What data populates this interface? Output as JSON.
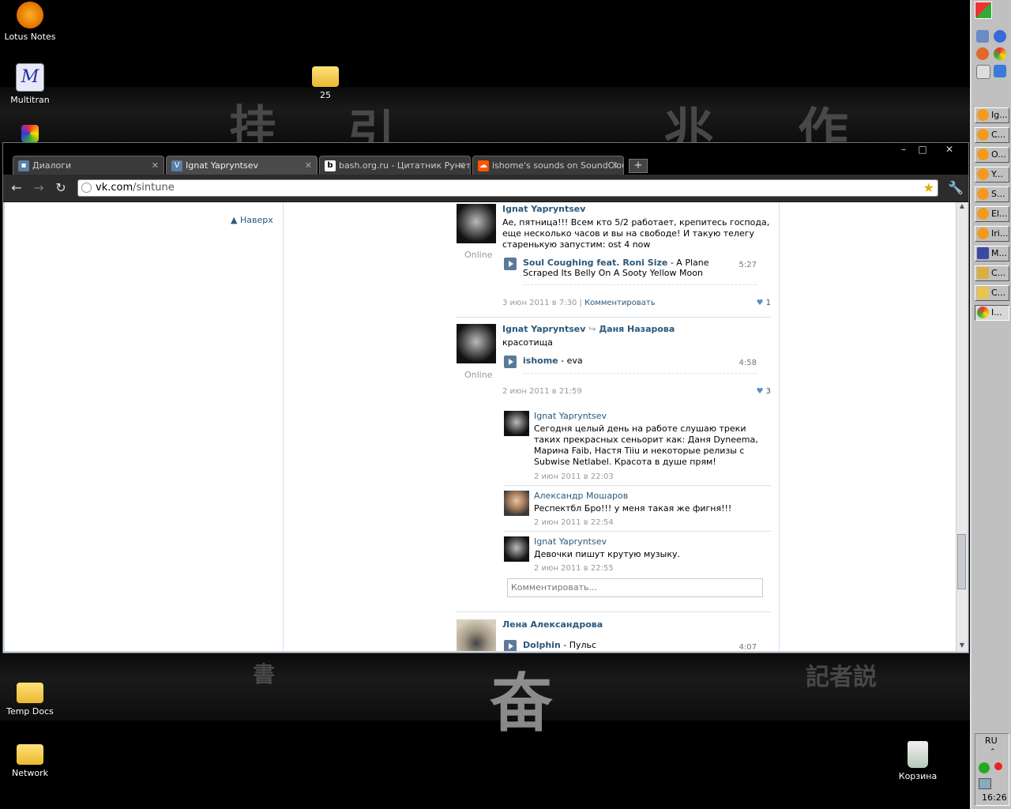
{
  "desktop": {
    "icons": [
      {
        "label": "Lotus Notes"
      },
      {
        "label": "Multitran"
      },
      {
        "label": "25"
      },
      {
        "label": "Temp Docs"
      },
      {
        "label": "Network"
      },
      {
        "label": "Корзина"
      }
    ]
  },
  "browser": {
    "tabs": [
      {
        "title": "Диалоги"
      },
      {
        "title": "Ignat Yapryntsev"
      },
      {
        "title": "bash.org.ru - Цитатник Рунета"
      },
      {
        "title": "ishome's sounds on SoundCloud"
      }
    ],
    "url_host": "vk.com",
    "url_path": "/sintune"
  },
  "page": {
    "naverh_label": "Наверх",
    "posts": [
      {
        "author": "Ignat Yapryntsev",
        "status": "Online",
        "text": "Ае, пятница!!! Всем кто 5/2 работает, крепитесь господа, еще несколько часов и вы на свободе! И такую телегу старенькую запустим: ost 4 now",
        "audio_artist": "Soul Coughing feat. Roni Size",
        "audio_title": " - A Plane Scraped Its Belly On A Sooty Yellow Moon",
        "audio_duration": "5:27",
        "date": "3 июн 2011 в 7:30",
        "comment_link": "Комментировать",
        "likes": "1"
      },
      {
        "author": "Ignat Yapryntsev",
        "target": "Даня Назарова",
        "status": "Online",
        "text": "красотища",
        "audio_artist": "ishome",
        "audio_title": " - eva",
        "audio_duration": "4:58",
        "date": "2 июн 2011 в 21:59",
        "likes": "3"
      },
      {
        "author": "Лена Александрова",
        "audio_artist": "Dolphin",
        "audio_title": " - Пульс",
        "audio_duration": "4:07"
      }
    ],
    "replies": [
      {
        "author": "Ignat Yapryntsev",
        "text": "Сегодня целый день на работе слушаю треки таких прекрасных сеньорит как: Даня Dyneema, Марина Faib, Настя Tiiu и некоторые релизы с Subwise Netlabel. Красота в душе прям!",
        "date": "2 июн 2011 в 22:03"
      },
      {
        "author": "Александр Мошаров",
        "text": "Респектбл Бро!!! у меня такая же фигня!!!",
        "date": "2 июн 2011 в 22:54"
      },
      {
        "author": "Ignat Yapryntsev",
        "text": "Девочки пишут крутую музыку.",
        "date": "2 июн 2011 в 22:55"
      }
    ],
    "comment_placeholder": "Комментировать..."
  },
  "taskbar": {
    "buttons": [
      {
        "label": "Ig...",
        "color": "#f39a1e"
      },
      {
        "label": "C...",
        "color": "#f39a1e"
      },
      {
        "label": "O...",
        "color": "#f39a1e"
      },
      {
        "label": "Y...",
        "color": "#f39a1e"
      },
      {
        "label": "S...",
        "color": "#f39a1e"
      },
      {
        "label": "El...",
        "color": "#f39a1e"
      },
      {
        "label": "Iri...",
        "color": "#f39a1e"
      },
      {
        "label": "M...",
        "color": "#3a4aa0"
      },
      {
        "label": "C...",
        "color": "#d8b040"
      },
      {
        "label": "C...",
        "color": "#e8c450"
      },
      {
        "label": "I...",
        "color": "#3aa04a"
      }
    ],
    "lang": "RU",
    "clock": "16:26"
  }
}
